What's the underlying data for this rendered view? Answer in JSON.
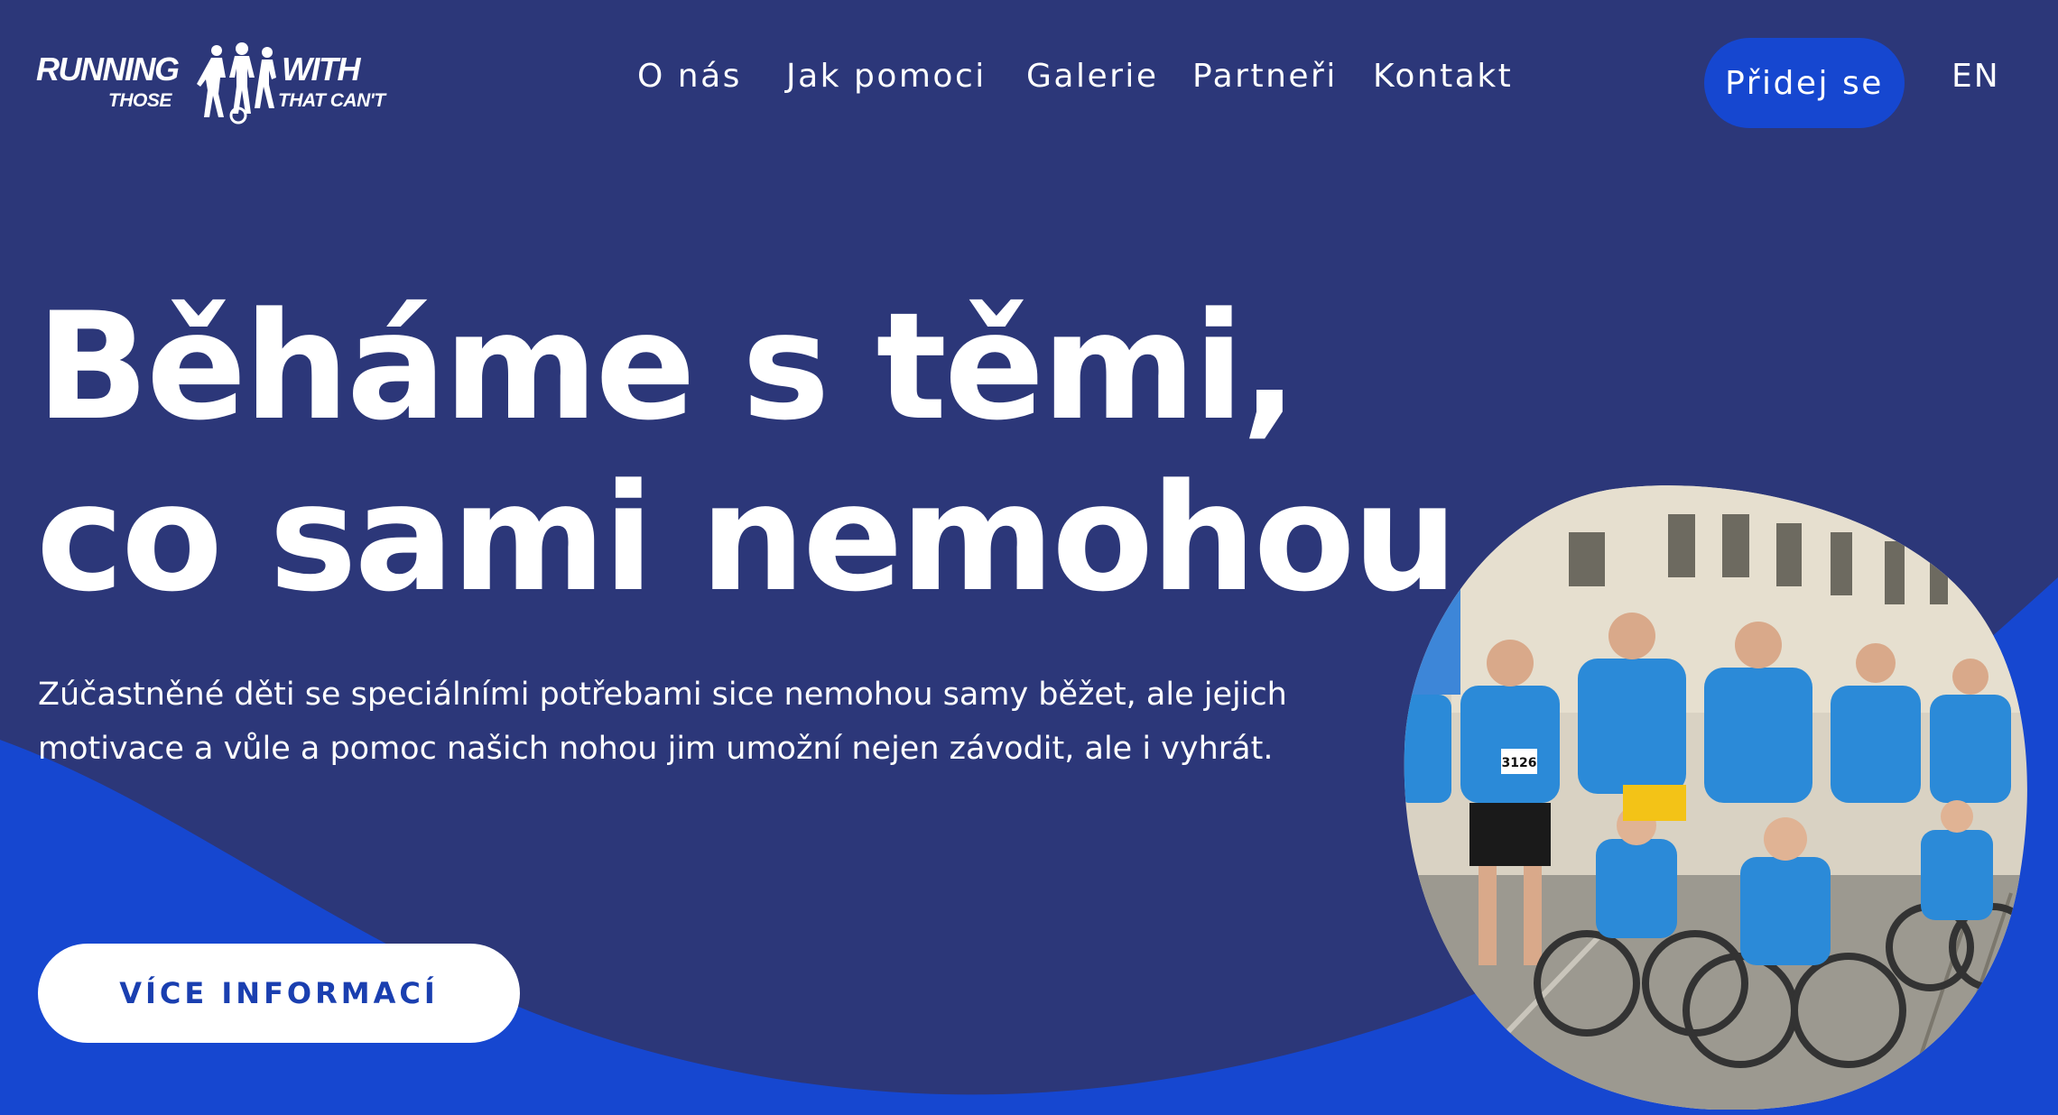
{
  "brand": {
    "logo_line1_left": "RUNNING",
    "logo_line1_right": "WITH",
    "logo_line2_left": "THOSE",
    "logo_line2_right": "THAT CAN'T"
  },
  "nav": {
    "items": [
      {
        "label": "O nás"
      },
      {
        "label": "Jak pomoci"
      },
      {
        "label": "Galerie"
      },
      {
        "label": "Partneři"
      },
      {
        "label": "Kontakt"
      }
    ],
    "cta_label": "Přidej se",
    "language": "EN"
  },
  "hero": {
    "title_line1": "Běháme s těmi,",
    "title_line2": "co sami nemohou",
    "text": "Zúčastněné děti se speciálními potřebami sice nemohou samy běžet, ale jejich motivace a vůle a pomoc našich nohou jim umožní nejen závodit, ale i vyhrát.",
    "button_label": "VÍCE INFORMACÍ",
    "photo_bib_number": "3126"
  },
  "colors": {
    "background": "#2c3779",
    "accent_wave": "#1647d0",
    "button_text": "#1a3fb0",
    "shirt_blue": "#2b8ad8"
  }
}
